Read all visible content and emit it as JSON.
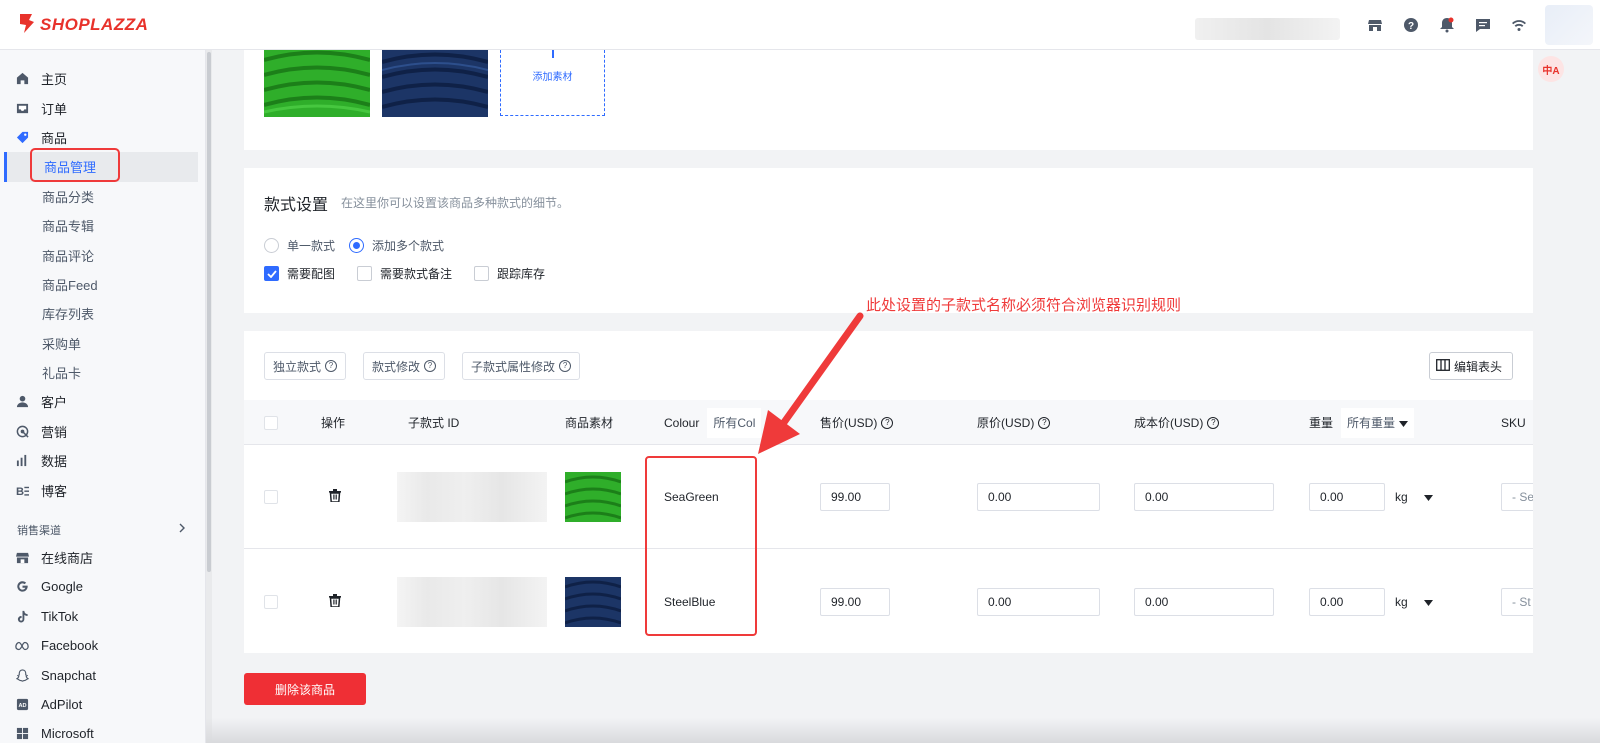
{
  "brand": {
    "name": "SHOPLAZZA",
    "color": "#e8322b"
  },
  "topbar": {
    "icons": [
      "store-icon",
      "help-icon",
      "bell-icon",
      "message-icon",
      "wifi-icon"
    ]
  },
  "sidebar": {
    "items": [
      {
        "label": "主页",
        "icon": "home-icon"
      },
      {
        "label": "订单",
        "icon": "inbox-icon"
      },
      {
        "label": "商品",
        "icon": "tag-icon"
      }
    ],
    "sub_items": [
      "商品管理",
      "商品分类",
      "商品专辑",
      "商品评论",
      "商品Feed",
      "库存列表",
      "采购单",
      "礼品卡"
    ],
    "items2": [
      {
        "label": "客户",
        "icon": "person-icon"
      },
      {
        "label": "营销",
        "icon": "marketing-icon"
      },
      {
        "label": "数据",
        "icon": "chart-icon"
      },
      {
        "label": "博客",
        "icon": "blog-icon"
      }
    ],
    "section_label": "销售渠道",
    "channels": [
      {
        "label": "在线商店",
        "icon": "store-icon"
      },
      {
        "label": "Google",
        "icon": "google-icon"
      },
      {
        "label": "TikTok",
        "icon": "tiktok-icon"
      },
      {
        "label": "Facebook",
        "icon": "meta-icon"
      },
      {
        "label": "Snapchat",
        "icon": "snapchat-icon"
      },
      {
        "label": "AdPilot",
        "icon": "ad-icon"
      },
      {
        "label": "Microsoft",
        "icon": "windows-icon"
      }
    ]
  },
  "media": {
    "add_label": "添加素材"
  },
  "variants": {
    "title": "款式设置",
    "hint": "在这里你可以设置该商品多种款式的细节。",
    "radio_single": "单一款式",
    "radio_multi": "添加多个款式",
    "check_image": "需要配图",
    "check_note": "需要款式备注",
    "check_inventory": "跟踪库存"
  },
  "annotation": "此处设置的子款式名称必须符合浏览器识别规则",
  "toolbar": {
    "btn_independent": "独立款式",
    "btn_modify": "款式修改",
    "btn_attr": "子款式属性修改",
    "btn_edit_header": "编辑表头"
  },
  "table": {
    "headers": {
      "action": "操作",
      "id": "子款式 ID",
      "media": "商品素材",
      "colour": "Colour",
      "colour_filter": "所有Col",
      "price": "售价(USD)",
      "compare": "原价(USD)",
      "cost": "成本价(USD)",
      "weight": "重量",
      "weight_filter": "所有重量",
      "sku": "SKU"
    },
    "rows": [
      {
        "colour": "SeaGreen",
        "price": "99.00",
        "compare": "0.00",
        "cost": "0.00",
        "weight": "0.00",
        "unit": "kg",
        "sku": "- Se",
        "swatch": "#2e9e2a"
      },
      {
        "colour": "SteelBlue",
        "price": "99.00",
        "compare": "0.00",
        "cost": "0.00",
        "weight": "0.00",
        "unit": "kg",
        "sku": "- St",
        "swatch": "#1f3a6e"
      }
    ]
  },
  "delete_button": "删除该商品",
  "colors": {
    "accent": "#2f6bff",
    "danger": "#ef2f35",
    "annotation": "#ef3a3a"
  }
}
